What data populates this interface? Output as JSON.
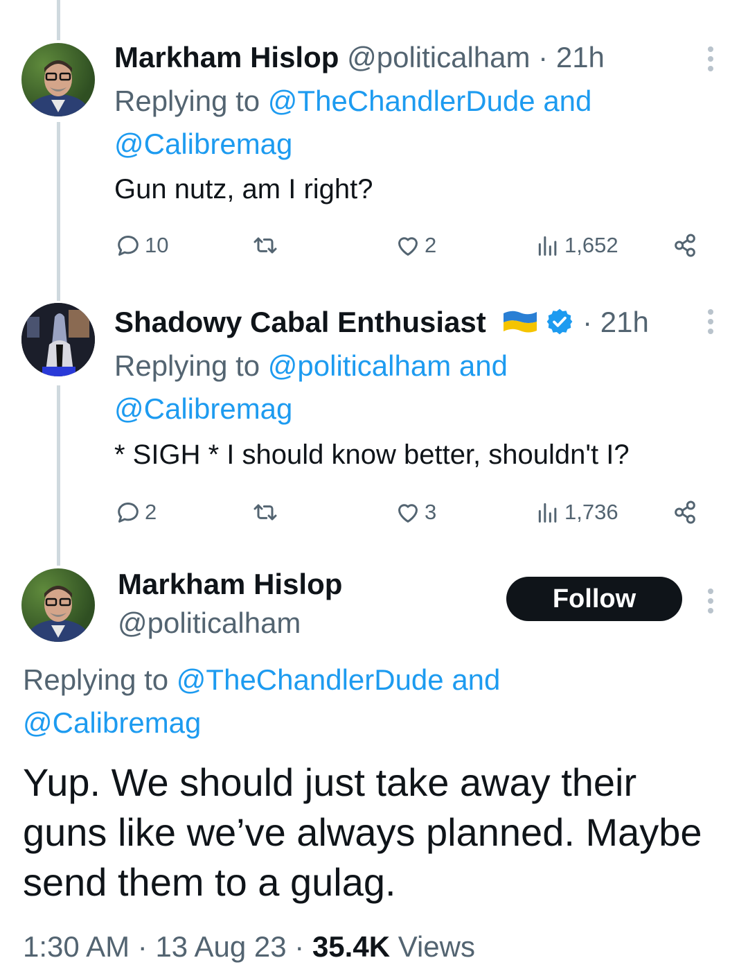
{
  "colors": {
    "link": "#1d9bf0",
    "muted": "#536471",
    "text": "#0f1419",
    "follow_bg": "#0f1419"
  },
  "replies": [
    {
      "name": "Markham Hislop",
      "handle": "@politicalham",
      "sep": " · ",
      "time": "21h",
      "replying_prefix": "Replying to ",
      "replying_to_1": "@TheChandlerDude and",
      "replying_to_2": "@Calibremag",
      "text": "Gun nutz, am I right?",
      "stats": {
        "replies": "10",
        "retweets": "",
        "likes": "2",
        "views": "1,652"
      }
    },
    {
      "name": "Shadowy Cabal Enthusiast",
      "flag": "ukraine-flag-icon",
      "verified": true,
      "sep": " · ",
      "time": "21h",
      "replying_prefix": "Replying to ",
      "replying_to_1": "@politicalham and",
      "replying_to_2": "@Calibremag",
      "text": "* SIGH * I should know better, shouldn't I?",
      "stats": {
        "replies": "2",
        "retweets": "",
        "likes": "3",
        "views": "1,736"
      }
    }
  ],
  "main": {
    "name": "Markham Hislop",
    "handle": "@politicalham",
    "follow_label": "Follow",
    "replying_prefix": "Replying to ",
    "replying_to_1": "@TheChandlerDude and",
    "replying_to_2": "@Calibremag",
    "text_line1": "Yup. We should just take away their",
    "text_line2": "guns like we’ve always planned. Maybe",
    "text_line3": "send them to a gulag.",
    "time": "1:30 AM",
    "dot1": " · ",
    "date": "13 Aug 23",
    "dot2": " · ",
    "views_count": "35.4K",
    "views_label": " Views"
  }
}
